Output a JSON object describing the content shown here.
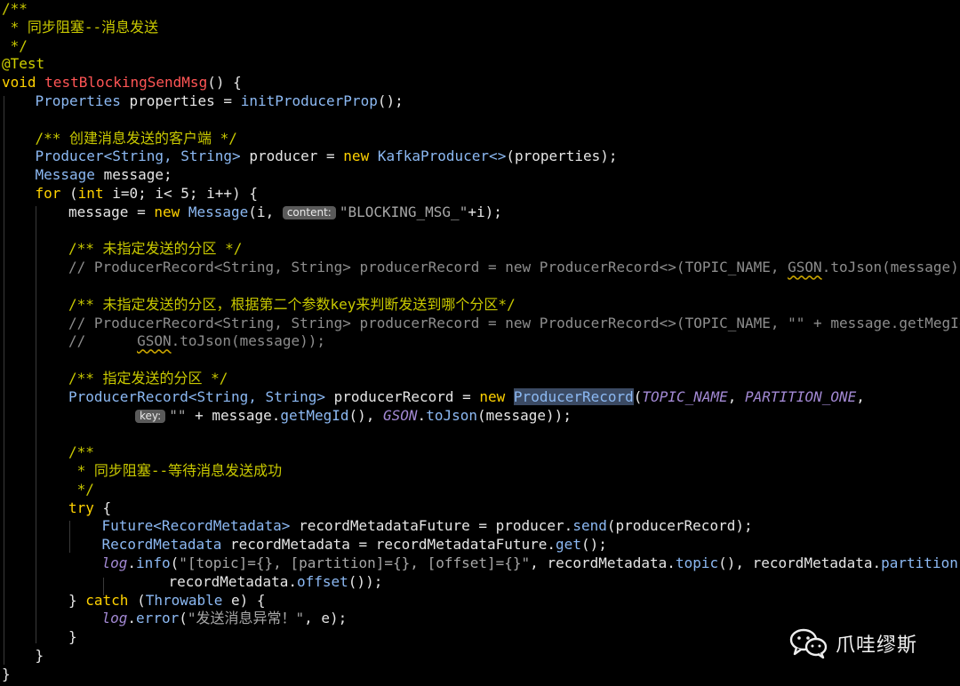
{
  "colors": {
    "comment_doc": "#c9c900",
    "comment_line": "#8d8d8d",
    "keyword": "#ffd200",
    "type": "#8cb9f3",
    "identifier": "#e6e6e6",
    "method_name": "#ff5555",
    "method_call": "#8cb9f3",
    "field": "#a389d4",
    "string": "#a7a7a7",
    "number": "#e6e6e6",
    "punct": "#e6e6e6",
    "annotation": "#d0d000",
    "log": "#a6a6d9"
  },
  "lines": [
    {
      "indent": 0,
      "tokens": [
        [
          "/**",
          "comment_doc"
        ]
      ]
    },
    {
      "indent": 0,
      "tokens": [
        [
          " * 同步阻塞--消息发送",
          "comment_doc"
        ]
      ]
    },
    {
      "indent": 0,
      "tokens": [
        [
          " */",
          "comment_doc"
        ]
      ]
    },
    {
      "indent": 0,
      "tokens": [
        [
          "@Test",
          "annotation"
        ]
      ]
    },
    {
      "indent": 0,
      "tokens": [
        [
          "void ",
          "keyword"
        ],
        [
          "testBlockingSendMsg",
          "method_name"
        ],
        [
          "() {",
          "punct"
        ]
      ]
    },
    {
      "indent": 1,
      "tokens": [
        [
          "Properties ",
          "type"
        ],
        [
          "properties = ",
          "identifier"
        ],
        [
          "initProducerProp",
          "method_call"
        ],
        [
          "();",
          "punct"
        ]
      ]
    },
    {
      "indent": 0,
      "tokens": []
    },
    {
      "indent": 1,
      "tokens": [
        [
          "/** ",
          "comment_doc"
        ],
        [
          "创建消息发送的客户端 */",
          "comment_doc"
        ]
      ]
    },
    {
      "indent": 1,
      "tokens": [
        [
          "Producer<String, String> ",
          "type"
        ],
        [
          "producer = ",
          "identifier"
        ],
        [
          "new ",
          "keyword"
        ],
        [
          "KafkaProducer<>",
          "type"
        ],
        [
          "(properties);",
          "punct"
        ]
      ]
    },
    {
      "indent": 1,
      "tokens": [
        [
          "Message ",
          "type"
        ],
        [
          "message;",
          "identifier"
        ]
      ]
    },
    {
      "indent": 1,
      "tokens": [
        [
          "for ",
          "keyword"
        ],
        [
          "(",
          "punct"
        ],
        [
          "int ",
          "keyword"
        ],
        [
          "i=0; i< 5; i++) {",
          "identifier"
        ]
      ]
    },
    {
      "indent": 2,
      "tokens": [
        [
          "message = ",
          "identifier"
        ],
        [
          "new ",
          "keyword"
        ],
        [
          "Message",
          "type"
        ],
        [
          "(i, ",
          "punct"
        ],
        [
          "content:",
          "hint"
        ],
        [
          "\"BLOCKING_MSG_\"",
          "string"
        ],
        [
          "+i);",
          "punct"
        ]
      ]
    },
    {
      "indent": 0,
      "tokens": []
    },
    {
      "indent": 2,
      "tokens": [
        [
          "/** ",
          "comment_doc"
        ],
        [
          "未指定发送的分区 */",
          "comment_doc"
        ]
      ]
    },
    {
      "indent": 2,
      "tokens": [
        [
          "// ProducerRecord<String, String> producerRecord = new ProducerRecord<>(TOPIC_NAME, ",
          "comment_line"
        ],
        [
          "GSON",
          "comment_line_squig"
        ],
        [
          ".toJson(message));",
          "comment_line"
        ]
      ]
    },
    {
      "indent": 0,
      "tokens": []
    },
    {
      "indent": 2,
      "tokens": [
        [
          "/** ",
          "comment_doc"
        ],
        [
          "未指定发送的分区，根据第二个参数key来判断发送到哪个分区*/",
          "comment_doc"
        ]
      ]
    },
    {
      "indent": 2,
      "tokens": [
        [
          "// ProducerRecord<String, String> producerRecord = new ProducerRecord<>(TOPIC_NAME, \"\" + message.getMegId(),",
          "comment_line"
        ]
      ]
    },
    {
      "indent": 2,
      "tokens": [
        [
          "//      ",
          "comment_line"
        ],
        [
          "GSON",
          "comment_line_squig"
        ],
        [
          ".toJson(message));",
          "comment_line"
        ]
      ]
    },
    {
      "indent": 0,
      "tokens": []
    },
    {
      "indent": 2,
      "tokens": [
        [
          "/** ",
          "comment_doc"
        ],
        [
          "指定发送的分区 */",
          "comment_doc"
        ]
      ]
    },
    {
      "indent": 2,
      "tokens": [
        [
          "ProducerRecord<String, String> ",
          "type"
        ],
        [
          "producerRecord = ",
          "identifier"
        ],
        [
          "new ",
          "keyword"
        ],
        [
          "ProducerRecord",
          "type_hl"
        ],
        [
          "(",
          "punct"
        ],
        [
          "TOPIC_NAME",
          "field"
        ],
        [
          ", ",
          "punct"
        ],
        [
          "PARTITION_ONE",
          "field"
        ],
        [
          ",",
          "punct"
        ]
      ]
    },
    {
      "indent": 4,
      "tokens": [
        [
          "key:",
          "hint"
        ],
        [
          "\"\" ",
          "string"
        ],
        [
          "+ message.",
          "identifier"
        ],
        [
          "getMegId",
          "method_call"
        ],
        [
          "(), ",
          "punct"
        ],
        [
          "GSON",
          "field"
        ],
        [
          ".",
          "punct"
        ],
        [
          "toJson",
          "method_call"
        ],
        [
          "(message));",
          "punct"
        ]
      ]
    },
    {
      "indent": 0,
      "tokens": []
    },
    {
      "indent": 2,
      "tokens": [
        [
          "/**",
          "comment_doc"
        ]
      ]
    },
    {
      "indent": 2,
      "tokens": [
        [
          " * 同步阻塞--等待消息发送成功",
          "comment_doc"
        ]
      ]
    },
    {
      "indent": 2,
      "tokens": [
        [
          " */",
          "comment_doc"
        ]
      ]
    },
    {
      "indent": 2,
      "tokens": [
        [
          "try ",
          "keyword"
        ],
        [
          "{",
          "punct"
        ]
      ]
    },
    {
      "indent": 3,
      "tokens": [
        [
          "Future<RecordMetadata> ",
          "type"
        ],
        [
          "recordMetadataFuture = producer.",
          "identifier"
        ],
        [
          "send",
          "method_call"
        ],
        [
          "(producerRecord);",
          "punct"
        ]
      ]
    },
    {
      "indent": 3,
      "tokens": [
        [
          "RecordMetadata ",
          "type"
        ],
        [
          "recordMetadata = recordMetadataFuture.",
          "identifier"
        ],
        [
          "get",
          "method_call"
        ],
        [
          "();",
          "punct"
        ]
      ]
    },
    {
      "indent": 3,
      "tokens": [
        [
          "log",
          "field"
        ],
        [
          ".",
          "punct"
        ],
        [
          "info",
          "method_call"
        ],
        [
          "(",
          "punct"
        ],
        [
          "\"[topic]={}, [partition]={}, [offset]={}\"",
          "string"
        ],
        [
          ", recordMetadata.",
          "identifier"
        ],
        [
          "topic",
          "method_call"
        ],
        [
          "(), recordMetadata.",
          "identifier"
        ],
        [
          "partition",
          "method_call"
        ],
        [
          "(),",
          "punct"
        ]
      ]
    },
    {
      "indent": 5,
      "tokens": [
        [
          "recordMetadata.",
          "identifier"
        ],
        [
          "offset",
          "method_call"
        ],
        [
          "());",
          "punct"
        ]
      ]
    },
    {
      "indent": 2,
      "tokens": [
        [
          "} ",
          "punct"
        ],
        [
          "catch ",
          "keyword"
        ],
        [
          "(",
          "punct"
        ],
        [
          "Throwable ",
          "type"
        ],
        [
          "e) {",
          "identifier"
        ]
      ]
    },
    {
      "indent": 3,
      "tokens": [
        [
          "log",
          "field"
        ],
        [
          ".",
          "punct"
        ],
        [
          "error",
          "method_call"
        ],
        [
          "(",
          "punct"
        ],
        [
          "\"发送消息异常！\"",
          "string"
        ],
        [
          ", e);",
          "punct"
        ]
      ]
    },
    {
      "indent": 2,
      "tokens": [
        [
          "}",
          "punct"
        ]
      ]
    },
    {
      "indent": 1,
      "tokens": [
        [
          "}",
          "punct"
        ]
      ]
    },
    {
      "indent": 0,
      "tokens": [
        [
          "}",
          "punct"
        ]
      ]
    }
  ],
  "watermark": {
    "icon": "wechat-icon",
    "text": "爪哇缪斯"
  }
}
